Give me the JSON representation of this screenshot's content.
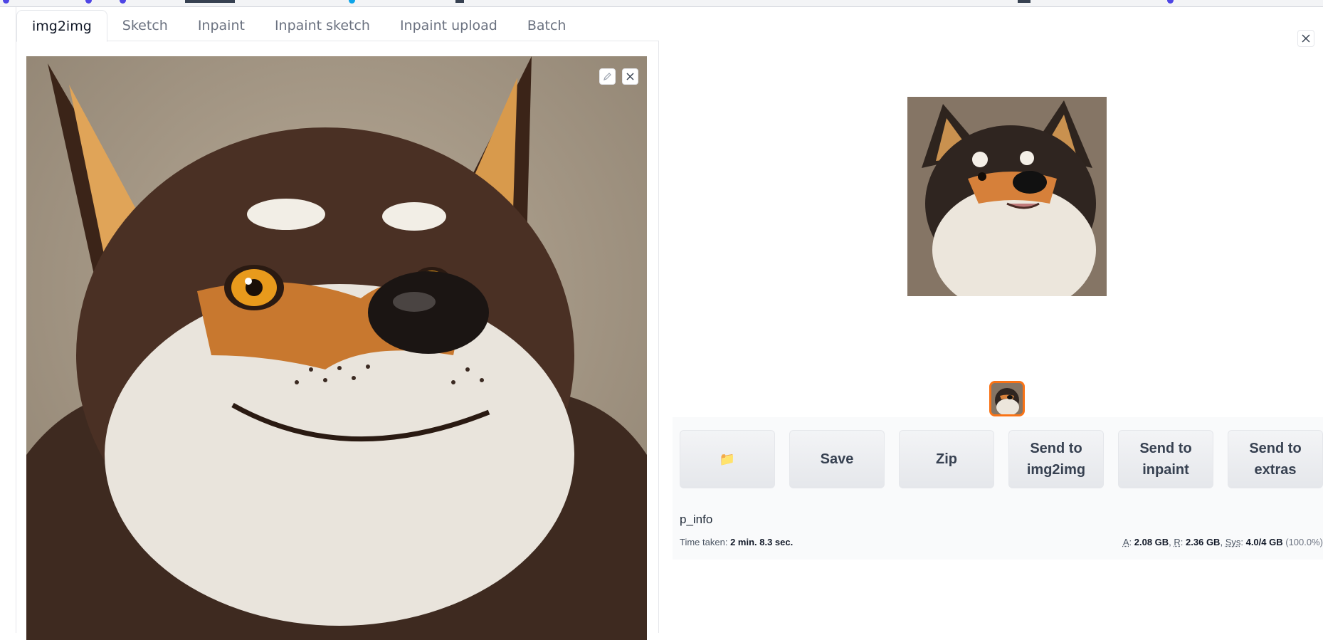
{
  "tabs": [
    {
      "label": "img2img",
      "active": true
    },
    {
      "label": "Sketch"
    },
    {
      "label": "Inpaint"
    },
    {
      "label": "Inpaint sketch"
    },
    {
      "label": "Inpaint upload"
    },
    {
      "label": "Batch"
    }
  ],
  "source_image": {
    "edit_icon": "pencil-icon",
    "clear_icon": "close-icon"
  },
  "gallery": {
    "close_icon": "close-icon",
    "selected_thumbnail_border": "#f97316"
  },
  "buttons": {
    "folder_icon": "📁",
    "save": "Save",
    "zip": "Zip",
    "send_img2img_1": "Send to",
    "send_img2img_2": "img2img",
    "send_inpaint_1": "Send to",
    "send_inpaint_2": "inpaint",
    "send_extras_1": "Send to",
    "send_extras_2": "extras"
  },
  "info": {
    "p_info": "p_info",
    "time_label": "Time taken:",
    "time_value": "2 min. 8.3 sec.",
    "a_label": "A",
    "a_value": "2.08 GB",
    "r_label": "R",
    "r_value": "2.36 GB",
    "sys_label": "Sys",
    "sys_value": "4.0/4 GB",
    "sys_pct": "(100.0%)"
  }
}
